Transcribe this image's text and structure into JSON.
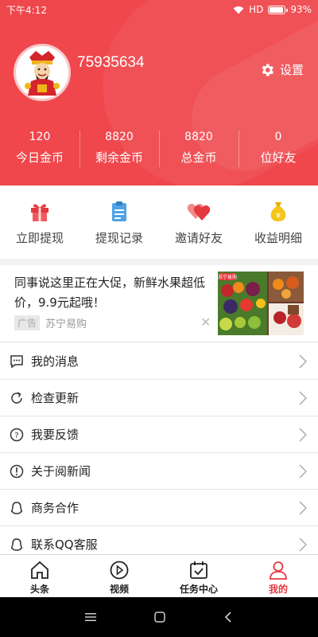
{
  "status_bar": {
    "time": "下午4:12",
    "network": "HD",
    "battery": "93%",
    "battery_level": 0.93
  },
  "profile": {
    "user_id": "75935634",
    "settings_label": "设置"
  },
  "stats": [
    {
      "value": "120",
      "label": "今日金币"
    },
    {
      "value": "8820",
      "label": "剩余金币"
    },
    {
      "value": "8820",
      "label": "总金币"
    },
    {
      "value": "0",
      "label": "位好友"
    }
  ],
  "quick_actions": [
    {
      "label": "立即提现",
      "icon": "gift-icon"
    },
    {
      "label": "提现记录",
      "icon": "clipboard-icon"
    },
    {
      "label": "邀请好友",
      "icon": "hearts-icon"
    },
    {
      "label": "收益明细",
      "icon": "money-bag-icon"
    }
  ],
  "ad": {
    "text": "同事说这里正在大促，新鲜水果超低价，9.9元起哦！",
    "badge": "广告",
    "source": "苏宁易购",
    "image_caption": "苏宁易购"
  },
  "menu": [
    {
      "label": "我的消息",
      "icon": "message-icon"
    },
    {
      "label": "检查更新",
      "icon": "refresh-icon"
    },
    {
      "label": "我要反馈",
      "icon": "question-icon"
    },
    {
      "label": "关于阅新闻",
      "icon": "info-icon"
    },
    {
      "label": "商务合作",
      "icon": "qq-icon"
    },
    {
      "label": "联系QQ客服",
      "icon": "qq-icon"
    }
  ],
  "tabs": [
    {
      "label": "头条",
      "icon": "home-icon"
    },
    {
      "label": "视频",
      "icon": "play-icon"
    },
    {
      "label": "任务中心",
      "icon": "calendar-check-icon"
    },
    {
      "label": "我的",
      "icon": "person-icon",
      "active": true
    }
  ],
  "colors": {
    "brand_red": "#ef474c",
    "active_tab": "#e5393f"
  }
}
